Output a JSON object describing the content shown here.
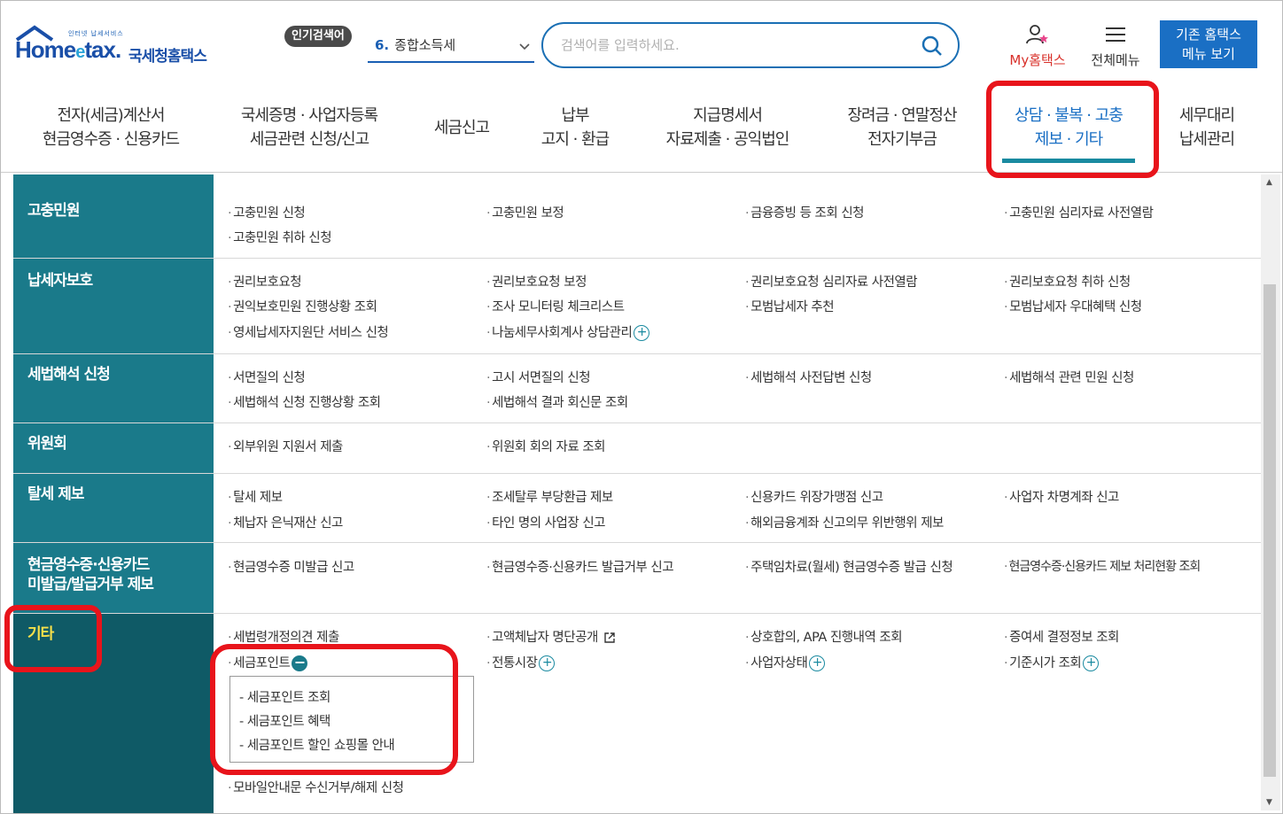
{
  "header": {
    "logo_small": "인터넷 납세서비스",
    "logo_main": "Home",
    "logo_e": "e",
    "logo_main2": "tax.",
    "logo_kor": "국세청홈택스",
    "popular_badge": "인기검색어",
    "popular_num": "6.",
    "popular_term": "종합소득세",
    "search_placeholder": "검색어를 입력하세요.",
    "myhometax": "My홈택스",
    "allmenu": "전체메뉴",
    "oldmenu_line1": "기존 홈택스",
    "oldmenu_line2": "메뉴 보기"
  },
  "nav": [
    {
      "line1": "전자(세금)계산서",
      "line2": "현금영수증 · 신용카드"
    },
    {
      "line1": "국세증명 · 사업자등록",
      "line2": "세금관련 신청/신고"
    },
    {
      "line1": "세금신고",
      "line2": ""
    },
    {
      "line1": "납부",
      "line2": "고지 · 환급"
    },
    {
      "line1": "지급명세서",
      "line2": "자료제출 · 공익법인"
    },
    {
      "line1": "장려금 · 연말정산",
      "line2": "전자기부금"
    },
    {
      "line1": "상담 · 불복 · 고충",
      "line2": "제보 · 기타"
    },
    {
      "line1": "세무대리",
      "line2": "납세관리"
    }
  ],
  "categories": {
    "c1": {
      "name": "고충민원",
      "items": [
        "고충민원 신청",
        "고충민원 보정",
        "금융증빙 등 조회 신청",
        "고충민원 심리자료 사전열람",
        "고충민원 취하 신청"
      ]
    },
    "c2": {
      "name": "납세자보호",
      "items": [
        "권리보호요청",
        "권리보호요청 보정",
        "권리보호요청 심리자료 사전열람",
        "권리보호요청 취하 신청",
        "권익보호민원 진행상황 조회",
        "조사 모니터링 체크리스트",
        "모범납세자 추천",
        "모범납세자 우대혜택 신청",
        "영세납세자지원단 서비스 신청",
        "나눔세무사회계사 상담관리"
      ]
    },
    "c3": {
      "name": "세법해석 신청",
      "items": [
        "서면질의 신청",
        "고시 서면질의 신청",
        "세법해석 사전답변 신청",
        "세법해석 관련 민원 신청",
        "세법해석 신청 진행상황 조회",
        "세법해석 결과 회신문 조회"
      ]
    },
    "c4": {
      "name": "위원회",
      "items": [
        "외부위원 지원서 제출",
        "위원회 회의 자료 조회"
      ]
    },
    "c5": {
      "name": "탈세 제보",
      "items": [
        "탈세 제보",
        "조세탈루 부당환급 제보",
        "신용카드 위장가맹점 신고",
        "사업자 차명계좌 신고",
        "체납자 은닉재산 신고",
        "타인 명의 사업장 신고",
        "해외금융계좌 신고의무 위반행위 제보"
      ]
    },
    "c6": {
      "name_line1": "현금영수증·신용카드",
      "name_line2": "미발급/발급거부 제보",
      "items": [
        "현금영수증 미발급 신고",
        "현금영수증·신용카드 발급거부 신고",
        "주택임차료(월세) 현금영수증 발급 신청",
        "현금영수증·신용카드 제보 처리현황 조회"
      ]
    },
    "c7": {
      "name": "기타",
      "items": [
        "세법령개정의견 제출",
        "고액체납자 명단공개",
        "상호합의, APA 진행내역 조회",
        "증여세 결정정보 조회",
        "세금포인트",
        "전통시장",
        "사업자상태",
        "기준시가 조회",
        "모바일안내문 수신거부/해제 신청"
      ],
      "submenu": [
        "- 세금포인트 조회",
        "- 세금포인트 혜택",
        "- 세금포인트 할인 쇼핑몰 안내"
      ]
    }
  },
  "colors": {
    "teal": "#1a7a8a",
    "highlight": "#e8141b",
    "accent": "#1a6fc4",
    "etc_text": "#f7e04a"
  }
}
